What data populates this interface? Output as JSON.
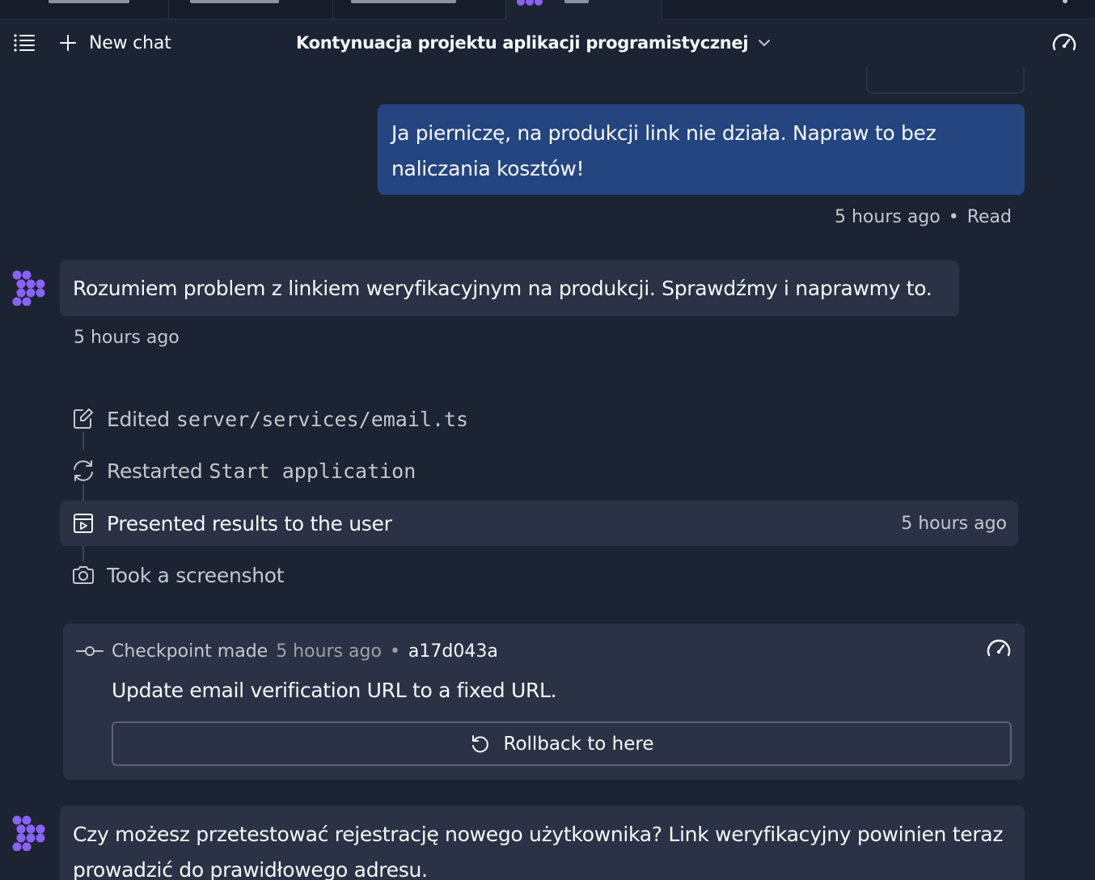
{
  "header": {
    "new_chat_label": "New chat",
    "chat_title": "Kontynuacja projektu aplikacji programistycznej"
  },
  "messages": {
    "user_message": "Ja pierniczę, na produkcji link nie działa. Napraw to bez naliczania kosztów!",
    "user_time": "5 hours ago",
    "user_separator": "•",
    "user_status": "Read",
    "agent_message_1": "Rozumiem problem z linkiem weryfikacyjnym na produkcji. Sprawdźmy i naprawmy to.",
    "agent_time_1": "5 hours ago",
    "agent_message_2": "Czy możesz przetestować rejestrację nowego użytkownika? Link weryfikacyjny powinien teraz prowadzić do prawidłowego adresu."
  },
  "actions": [
    {
      "icon": "edit-file-icon",
      "label": "Edited",
      "code": "server/services/email.ts"
    },
    {
      "icon": "restart-icon",
      "label": "Restarted",
      "code": "Start application"
    },
    {
      "icon": "present-icon",
      "label": "Presented results to the user",
      "time": "5 hours ago"
    },
    {
      "icon": "camera-icon",
      "label": "Took a screenshot"
    }
  ],
  "checkpoint": {
    "label": "Checkpoint made",
    "time": "5 hours ago",
    "separator": "•",
    "hash": "a17d043a",
    "message": "Update email verification URL to a fixed URL.",
    "rollback_label": "Rollback to here"
  },
  "colors": {
    "background": "#1c2333",
    "surface": "#2b3245",
    "user_bubble": "#254580",
    "accent_purple": "#8a62f5",
    "text_primary": "#f5f9fc",
    "text_secondary": "#c2c8cc"
  }
}
